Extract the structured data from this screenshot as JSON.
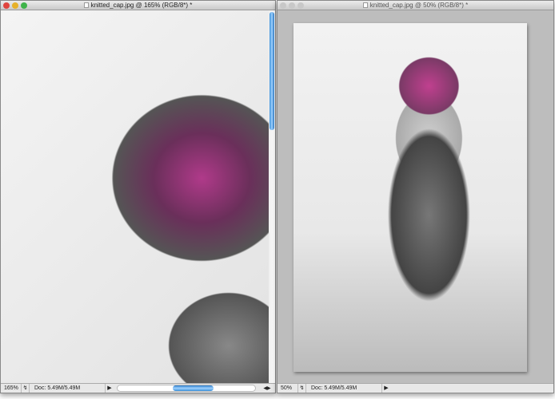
{
  "windows": [
    {
      "title": "knitted_cap.jpg @ 165% (RGB/8*) *",
      "zoom": "165%",
      "doc_info": "Doc: 5.49M/5.49M",
      "active": true
    },
    {
      "title": "knitted_cap.jpg @ 50% (RGB/8*) *",
      "zoom": "50%",
      "doc_info": "Doc: 5.49M/5.49M",
      "active": false
    }
  ],
  "colors": {
    "close": "#e0443e",
    "minimize": "#e6b12a",
    "zoom": "#3fb34a",
    "inactive": "#c8c8c8",
    "scroll_accent": "#3b8fd8"
  }
}
